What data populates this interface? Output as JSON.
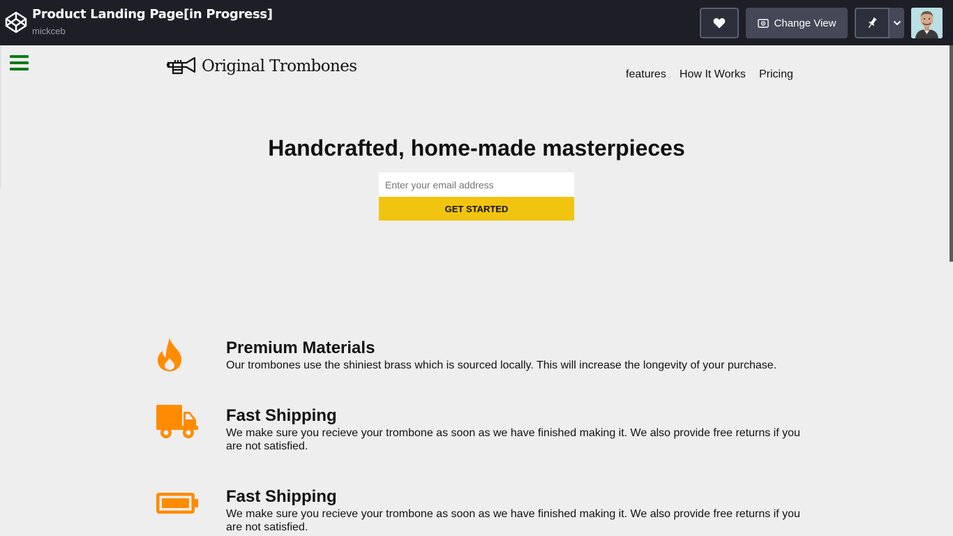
{
  "codepen": {
    "pen_title": "Product Landing Page[in Progress]",
    "author": "mickceb",
    "change_view_label": "Change View",
    "icons": [
      "codepen-logo-icon",
      "heart-icon",
      "eye-icon",
      "pin-icon",
      "chevron-down-icon"
    ]
  },
  "page": {
    "brand_name": "Original Trombones",
    "nav": [
      "features",
      "How It Works",
      "Pricing"
    ],
    "hero": {
      "title": "Handcrafted, home-made masterpieces",
      "email_placeholder": "Enter your email address",
      "cta_label": "GET STARTED"
    },
    "features": [
      {
        "icon": "fire-icon",
        "title": "Premium Materials",
        "text": "Our trombones use the shiniest brass which is sourced locally. This will increase the longevity of your purchase."
      },
      {
        "icon": "truck-icon",
        "title": "Fast Shipping",
        "text": "We make sure you recieve your trombone as soon as we have finished making it. We also provide free returns if you are not satisfied."
      },
      {
        "icon": "battery-icon",
        "title": "Fast Shipping",
        "text": "We make sure you recieve your trombone as soon as we have finished making it. We also provide free returns if you are not satisfied."
      }
    ],
    "colors": {
      "accent": "#f1c40f",
      "icon": "#ff8c00",
      "menu": "#0d7a17",
      "topbar": "#1e1f26"
    }
  }
}
